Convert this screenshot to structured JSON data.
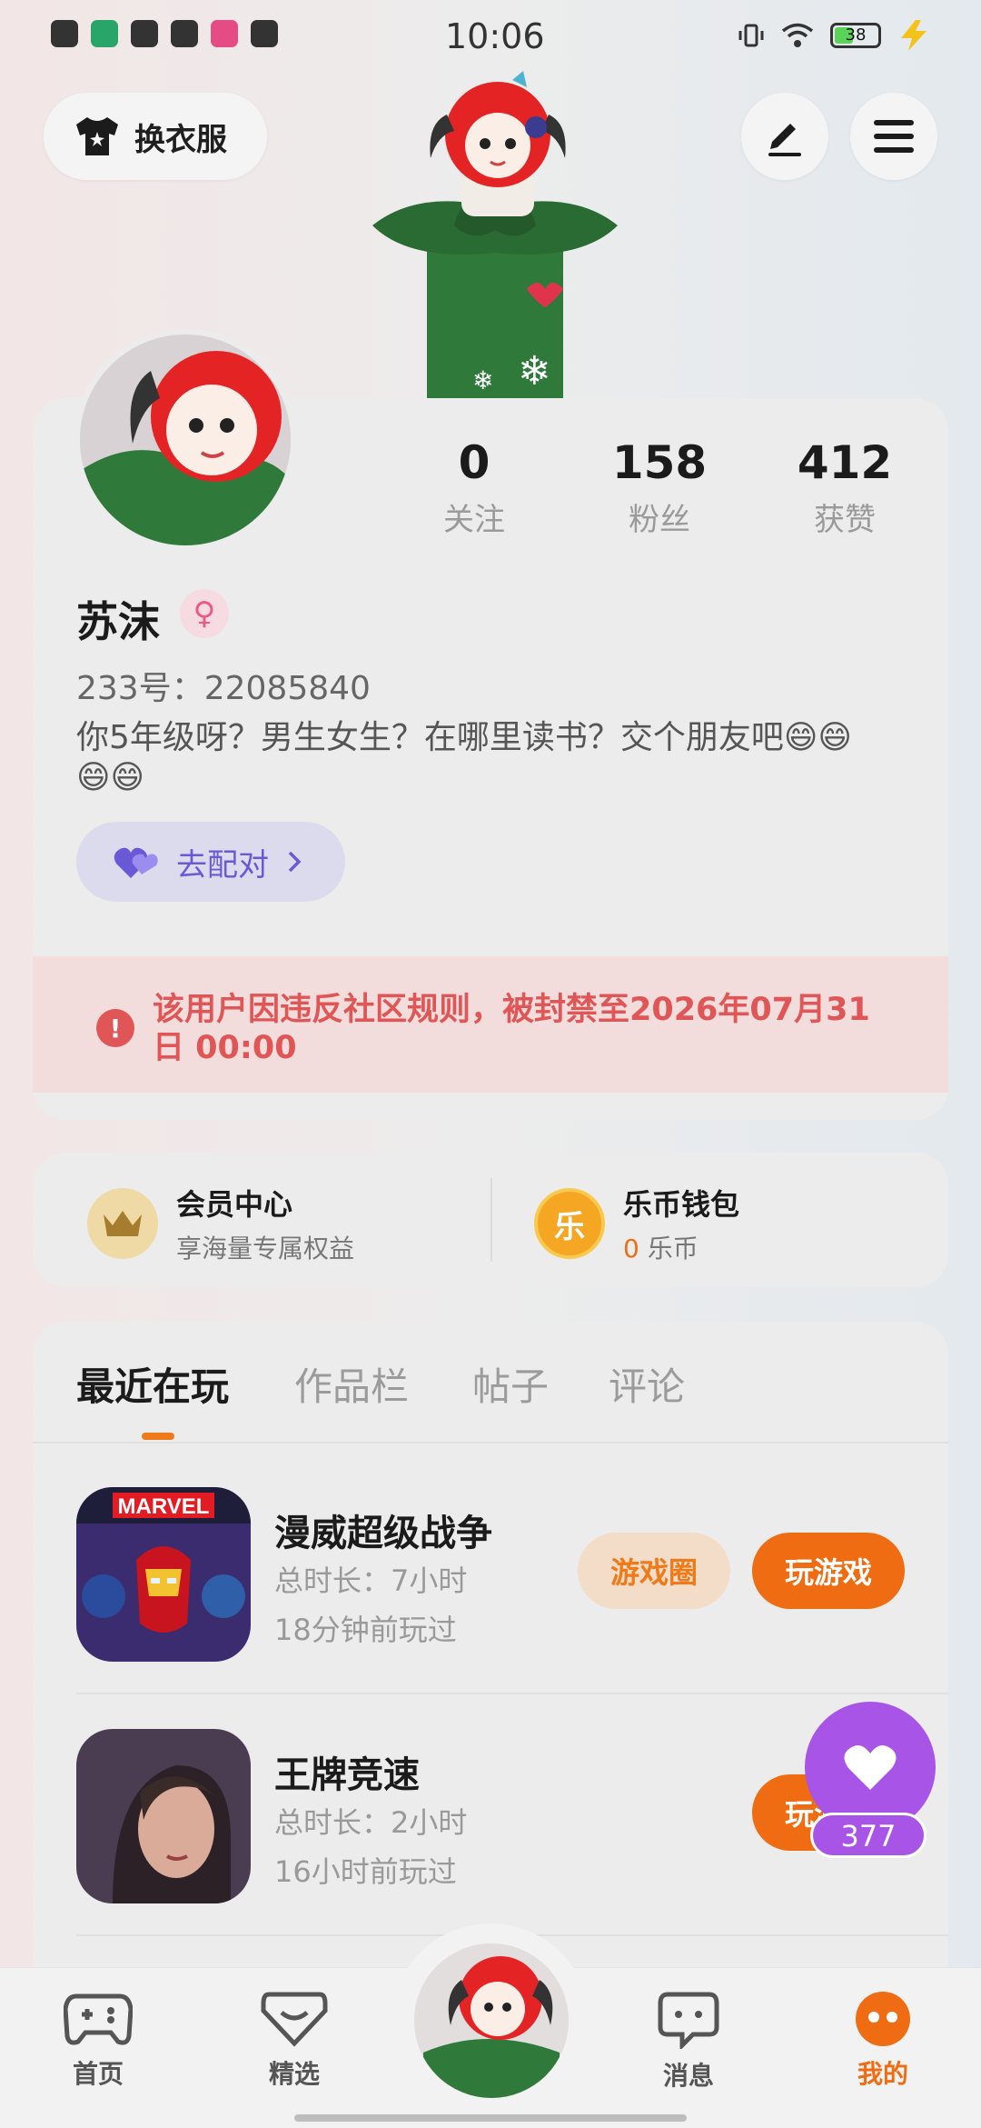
{
  "status_bar": {
    "time": "10:06",
    "battery": "38"
  },
  "top": {
    "dress_up_label": "换衣服"
  },
  "profile": {
    "stats": [
      {
        "value": "0",
        "label": "关注"
      },
      {
        "value": "158",
        "label": "粉丝"
      },
      {
        "value": "412",
        "label": "获赞"
      }
    ],
    "name": "苏沫",
    "gender_symbol": "♀",
    "uid": "233号：22085840",
    "bio_line1": "你5年级呀？男生女生？在哪里读书？交个朋友吧😄😄",
    "bio_line2": "😄😄",
    "match_label": "去配对",
    "ban_notice": "该用户因违反社区规则，被封禁至2026年07月31日 00:00"
  },
  "member": {
    "title": "会员中心",
    "subtitle": "享海量专属权益"
  },
  "wallet": {
    "title": "乐币钱包",
    "amount": "0",
    "unit": "乐币",
    "icon_text": "乐"
  },
  "tabs": [
    {
      "label": "最近在玩",
      "active": true
    },
    {
      "label": "作品栏",
      "active": false
    },
    {
      "label": "帖子",
      "active": false
    },
    {
      "label": "评论",
      "active": false
    }
  ],
  "games": [
    {
      "name": "漫威超级战争",
      "duration": "总时长：7小时",
      "last_played": "18分钟前玩过",
      "circle_label": "游戏圈",
      "play_label": "玩游戏",
      "icon_text": "MARVEL"
    },
    {
      "name": "王牌竞速",
      "duration": "总时长：2小时",
      "last_played": "16小时前玩过",
      "play_label": "玩游戏"
    }
  ],
  "like": {
    "count": "377"
  },
  "bottom_nav": [
    {
      "label": "首页",
      "active": false
    },
    {
      "label": "精选",
      "active": false
    },
    {
      "label": "消息",
      "active": false
    },
    {
      "label": "我的",
      "active": true
    }
  ],
  "colors": {
    "accent": "#ef6c12",
    "purple": "#a854e6",
    "ban_red": "#e05555"
  }
}
